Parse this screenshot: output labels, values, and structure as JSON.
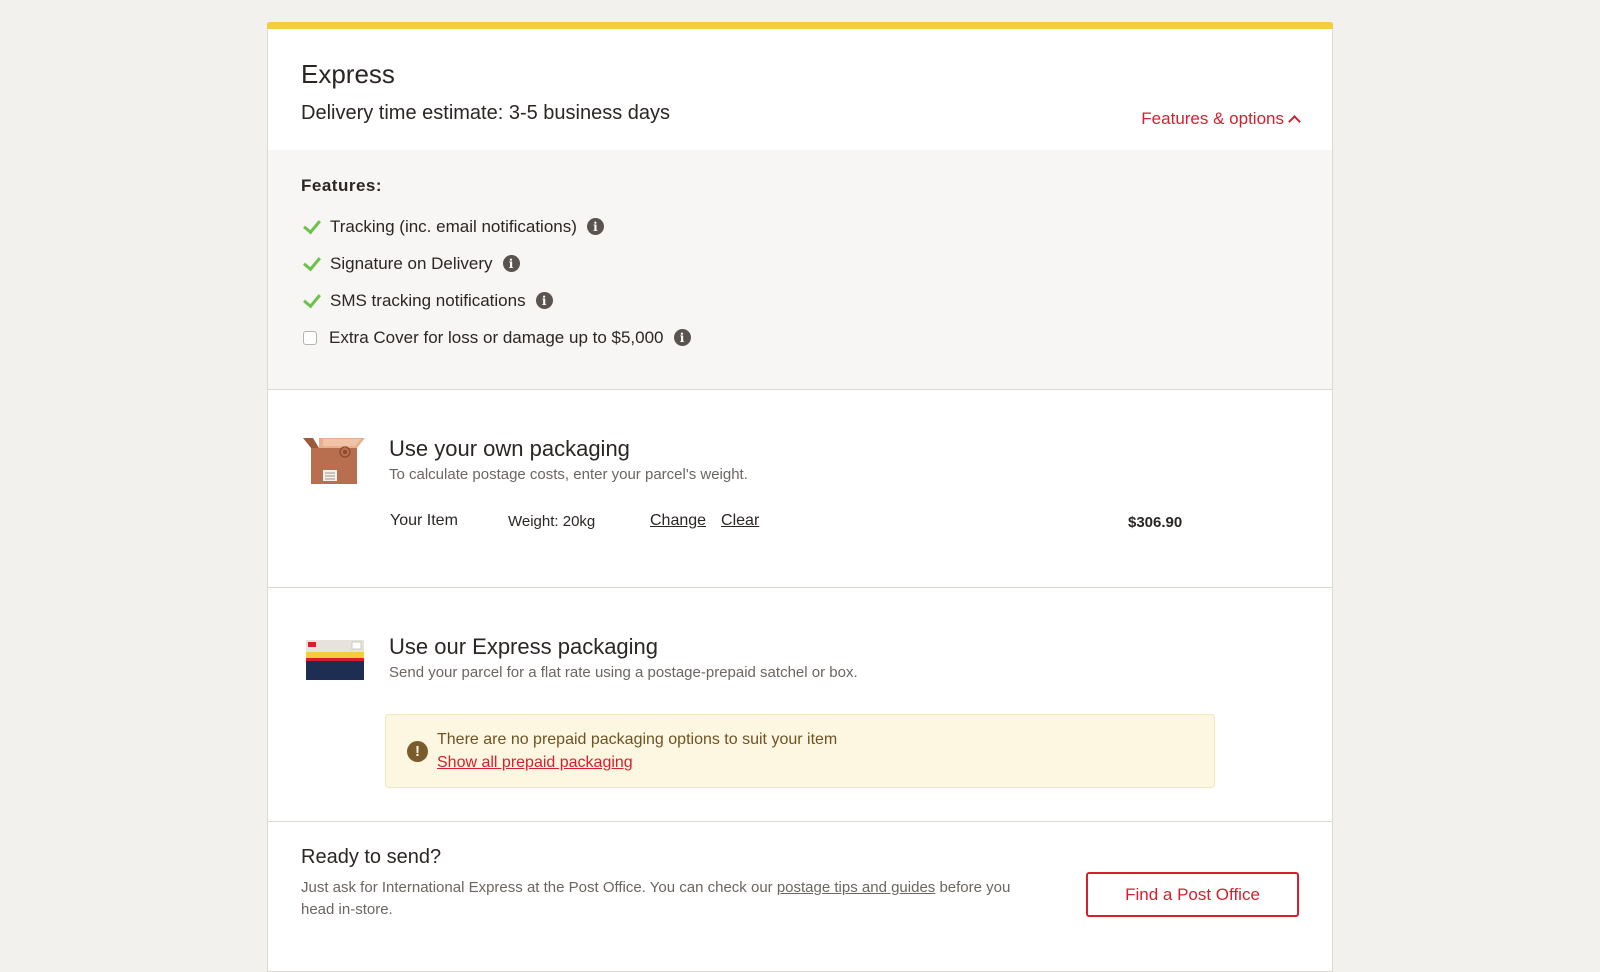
{
  "service": {
    "title": "Express",
    "delivery_estimate": "Delivery time estimate: 3-5 business days",
    "features_toggle_label": "Features & options"
  },
  "features": {
    "heading": "Features:",
    "items": [
      {
        "label": "Tracking (inc. email notifications)",
        "included": true
      },
      {
        "label": "Signature on Delivery",
        "included": true
      },
      {
        "label": "SMS tracking notifications",
        "included": true
      },
      {
        "label": "Extra Cover for loss or damage up to $5,000",
        "included": false
      }
    ]
  },
  "own_packaging": {
    "title": "Use your own packaging",
    "subtitle": "To calculate postage costs, enter your parcel's weight.",
    "item_label": "Your Item",
    "weight": "Weight: 20kg",
    "change_label": "Change",
    "clear_label": "Clear",
    "price": "$306.90"
  },
  "express_packaging": {
    "title": "Use our Express packaging",
    "subtitle": "Send your parcel for a flat rate using a postage-prepaid satchel or box.",
    "notice_text": "There are no prepaid packaging options to suit your item",
    "notice_link": "Show all prepaid packaging"
  },
  "ready": {
    "title": "Ready to send?",
    "text_before": "Just ask for International Express at the Post Office. You can check our ",
    "link": "postage tips and guides",
    "text_after": " before you head in-store.",
    "button_label": "Find a Post Office"
  },
  "colors": {
    "accent_red": "#d61f2c",
    "top_bar_yellow": "#f5cc3c",
    "check_green": "#6cc24a"
  }
}
